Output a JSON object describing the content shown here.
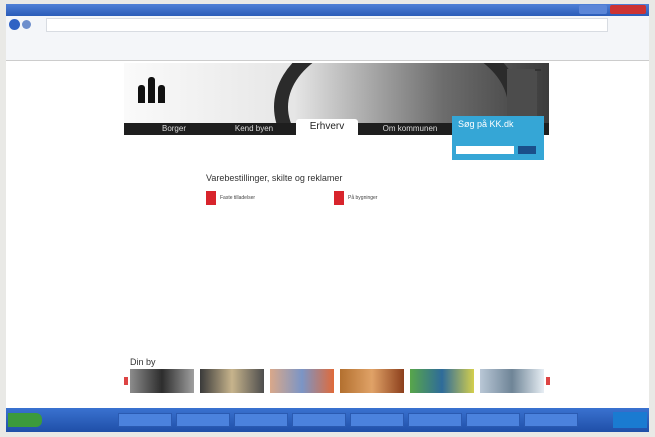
{
  "window": {
    "title": ""
  },
  "browser": {
    "url": "",
    "menu": [],
    "favorites": [],
    "tab_label": "",
    "toolbar_right": ""
  },
  "site": {
    "logo_text": "",
    "top_links": "",
    "nav": [
      {
        "label": "Borger"
      },
      {
        "label": "Kend byen"
      },
      {
        "label": "Erhverv",
        "active": true
      },
      {
        "label": "Om kommunen"
      }
    ],
    "search": {
      "heading": "Søg på KK.dk",
      "subtitle": "",
      "placeholder": "",
      "button": ""
    },
    "sublinks": [
      [],
      [],
      []
    ],
    "left_nav": [],
    "content": {
      "heading": "Varebestillinger, skilte og reklamer",
      "card1": "Faste tilladelser",
      "card2": "På bygninger",
      "paragraphs": []
    },
    "footer_links": [],
    "ribbon": {
      "title": "Din by",
      "captions": []
    }
  },
  "taskbar": {
    "start": "",
    "items": [],
    "clock": ""
  },
  "colors": {
    "search_blue": "#35a6d6",
    "nav_dark": "#1e1e1e",
    "card_red": "#d8242c",
    "taskbar_blue": "#2a5cb8"
  }
}
